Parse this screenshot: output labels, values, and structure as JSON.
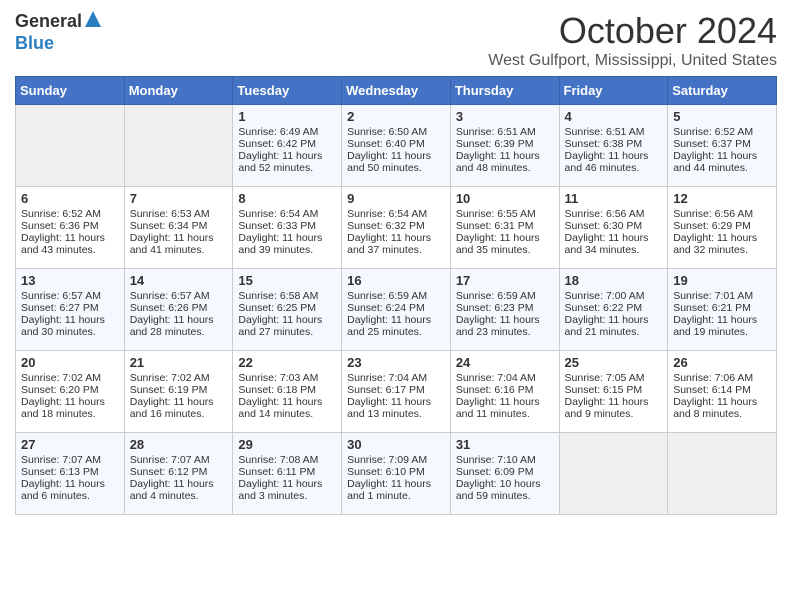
{
  "header": {
    "logo_general": "General",
    "logo_blue": "Blue",
    "month_title": "October 2024",
    "location": "West Gulfport, Mississippi, United States"
  },
  "days_of_week": [
    "Sunday",
    "Monday",
    "Tuesday",
    "Wednesday",
    "Thursday",
    "Friday",
    "Saturday"
  ],
  "weeks": [
    [
      {
        "day": "",
        "sunrise": "",
        "sunset": "",
        "daylight": ""
      },
      {
        "day": "",
        "sunrise": "",
        "sunset": "",
        "daylight": ""
      },
      {
        "day": "1",
        "sunrise": "Sunrise: 6:49 AM",
        "sunset": "Sunset: 6:42 PM",
        "daylight": "Daylight: 11 hours and 52 minutes."
      },
      {
        "day": "2",
        "sunrise": "Sunrise: 6:50 AM",
        "sunset": "Sunset: 6:40 PM",
        "daylight": "Daylight: 11 hours and 50 minutes."
      },
      {
        "day": "3",
        "sunrise": "Sunrise: 6:51 AM",
        "sunset": "Sunset: 6:39 PM",
        "daylight": "Daylight: 11 hours and 48 minutes."
      },
      {
        "day": "4",
        "sunrise": "Sunrise: 6:51 AM",
        "sunset": "Sunset: 6:38 PM",
        "daylight": "Daylight: 11 hours and 46 minutes."
      },
      {
        "day": "5",
        "sunrise": "Sunrise: 6:52 AM",
        "sunset": "Sunset: 6:37 PM",
        "daylight": "Daylight: 11 hours and 44 minutes."
      }
    ],
    [
      {
        "day": "6",
        "sunrise": "Sunrise: 6:52 AM",
        "sunset": "Sunset: 6:36 PM",
        "daylight": "Daylight: 11 hours and 43 minutes."
      },
      {
        "day": "7",
        "sunrise": "Sunrise: 6:53 AM",
        "sunset": "Sunset: 6:34 PM",
        "daylight": "Daylight: 11 hours and 41 minutes."
      },
      {
        "day": "8",
        "sunrise": "Sunrise: 6:54 AM",
        "sunset": "Sunset: 6:33 PM",
        "daylight": "Daylight: 11 hours and 39 minutes."
      },
      {
        "day": "9",
        "sunrise": "Sunrise: 6:54 AM",
        "sunset": "Sunset: 6:32 PM",
        "daylight": "Daylight: 11 hours and 37 minutes."
      },
      {
        "day": "10",
        "sunrise": "Sunrise: 6:55 AM",
        "sunset": "Sunset: 6:31 PM",
        "daylight": "Daylight: 11 hours and 35 minutes."
      },
      {
        "day": "11",
        "sunrise": "Sunrise: 6:56 AM",
        "sunset": "Sunset: 6:30 PM",
        "daylight": "Daylight: 11 hours and 34 minutes."
      },
      {
        "day": "12",
        "sunrise": "Sunrise: 6:56 AM",
        "sunset": "Sunset: 6:29 PM",
        "daylight": "Daylight: 11 hours and 32 minutes."
      }
    ],
    [
      {
        "day": "13",
        "sunrise": "Sunrise: 6:57 AM",
        "sunset": "Sunset: 6:27 PM",
        "daylight": "Daylight: 11 hours and 30 minutes."
      },
      {
        "day": "14",
        "sunrise": "Sunrise: 6:57 AM",
        "sunset": "Sunset: 6:26 PM",
        "daylight": "Daylight: 11 hours and 28 minutes."
      },
      {
        "day": "15",
        "sunrise": "Sunrise: 6:58 AM",
        "sunset": "Sunset: 6:25 PM",
        "daylight": "Daylight: 11 hours and 27 minutes."
      },
      {
        "day": "16",
        "sunrise": "Sunrise: 6:59 AM",
        "sunset": "Sunset: 6:24 PM",
        "daylight": "Daylight: 11 hours and 25 minutes."
      },
      {
        "day": "17",
        "sunrise": "Sunrise: 6:59 AM",
        "sunset": "Sunset: 6:23 PM",
        "daylight": "Daylight: 11 hours and 23 minutes."
      },
      {
        "day": "18",
        "sunrise": "Sunrise: 7:00 AM",
        "sunset": "Sunset: 6:22 PM",
        "daylight": "Daylight: 11 hours and 21 minutes."
      },
      {
        "day": "19",
        "sunrise": "Sunrise: 7:01 AM",
        "sunset": "Sunset: 6:21 PM",
        "daylight": "Daylight: 11 hours and 19 minutes."
      }
    ],
    [
      {
        "day": "20",
        "sunrise": "Sunrise: 7:02 AM",
        "sunset": "Sunset: 6:20 PM",
        "daylight": "Daylight: 11 hours and 18 minutes."
      },
      {
        "day": "21",
        "sunrise": "Sunrise: 7:02 AM",
        "sunset": "Sunset: 6:19 PM",
        "daylight": "Daylight: 11 hours and 16 minutes."
      },
      {
        "day": "22",
        "sunrise": "Sunrise: 7:03 AM",
        "sunset": "Sunset: 6:18 PM",
        "daylight": "Daylight: 11 hours and 14 minutes."
      },
      {
        "day": "23",
        "sunrise": "Sunrise: 7:04 AM",
        "sunset": "Sunset: 6:17 PM",
        "daylight": "Daylight: 11 hours and 13 minutes."
      },
      {
        "day": "24",
        "sunrise": "Sunrise: 7:04 AM",
        "sunset": "Sunset: 6:16 PM",
        "daylight": "Daylight: 11 hours and 11 minutes."
      },
      {
        "day": "25",
        "sunrise": "Sunrise: 7:05 AM",
        "sunset": "Sunset: 6:15 PM",
        "daylight": "Daylight: 11 hours and 9 minutes."
      },
      {
        "day": "26",
        "sunrise": "Sunrise: 7:06 AM",
        "sunset": "Sunset: 6:14 PM",
        "daylight": "Daylight: 11 hours and 8 minutes."
      }
    ],
    [
      {
        "day": "27",
        "sunrise": "Sunrise: 7:07 AM",
        "sunset": "Sunset: 6:13 PM",
        "daylight": "Daylight: 11 hours and 6 minutes."
      },
      {
        "day": "28",
        "sunrise": "Sunrise: 7:07 AM",
        "sunset": "Sunset: 6:12 PM",
        "daylight": "Daylight: 11 hours and 4 minutes."
      },
      {
        "day": "29",
        "sunrise": "Sunrise: 7:08 AM",
        "sunset": "Sunset: 6:11 PM",
        "daylight": "Daylight: 11 hours and 3 minutes."
      },
      {
        "day": "30",
        "sunrise": "Sunrise: 7:09 AM",
        "sunset": "Sunset: 6:10 PM",
        "daylight": "Daylight: 11 hours and 1 minute."
      },
      {
        "day": "31",
        "sunrise": "Sunrise: 7:10 AM",
        "sunset": "Sunset: 6:09 PM",
        "daylight": "Daylight: 10 hours and 59 minutes."
      },
      {
        "day": "",
        "sunrise": "",
        "sunset": "",
        "daylight": ""
      },
      {
        "day": "",
        "sunrise": "",
        "sunset": "",
        "daylight": ""
      }
    ]
  ]
}
